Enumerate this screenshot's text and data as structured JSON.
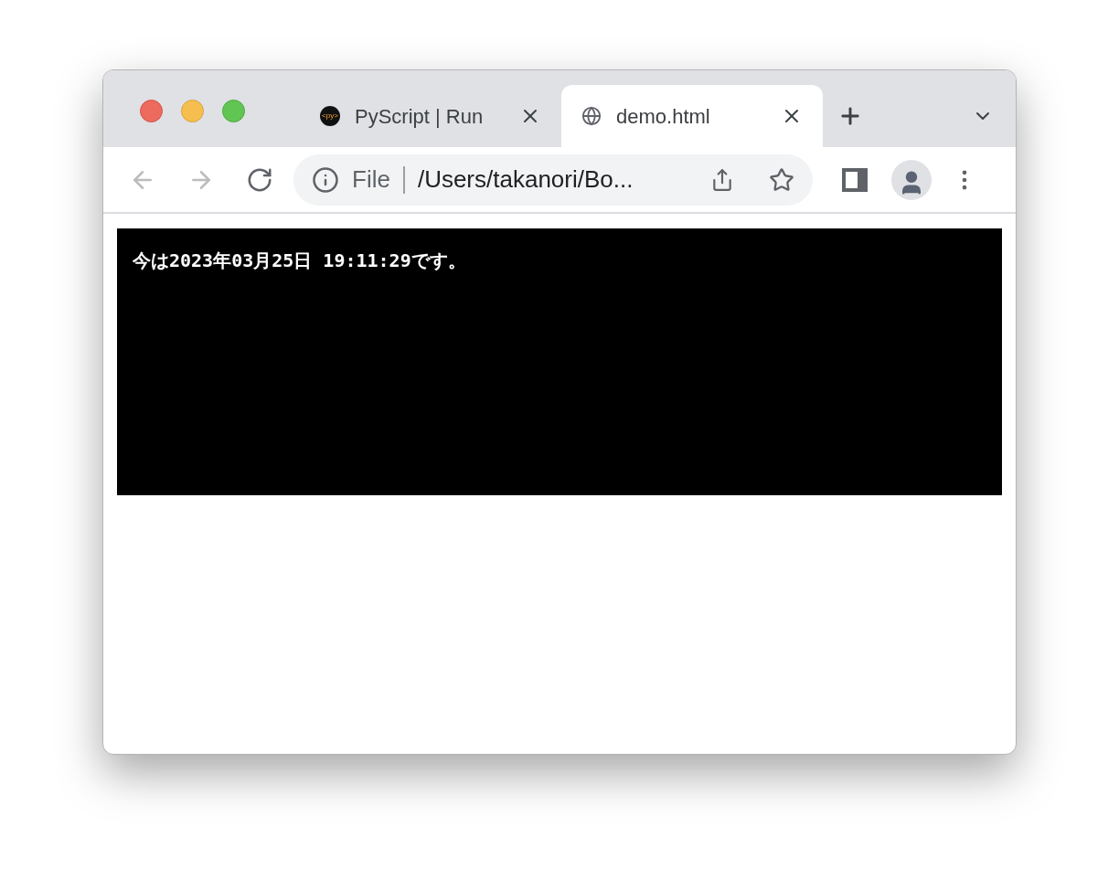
{
  "tabs": [
    {
      "title": "PyScript | Run",
      "kind": "pyscript",
      "favicon_text": "<py>",
      "selected": false
    },
    {
      "title": "demo.html",
      "kind": "globe",
      "selected": true
    }
  ],
  "address_bar": {
    "scheme_label": "File",
    "url": "/Users/takanori/Bo..."
  },
  "page": {
    "output": "今は2023年03月25日 19:11:29です。"
  }
}
